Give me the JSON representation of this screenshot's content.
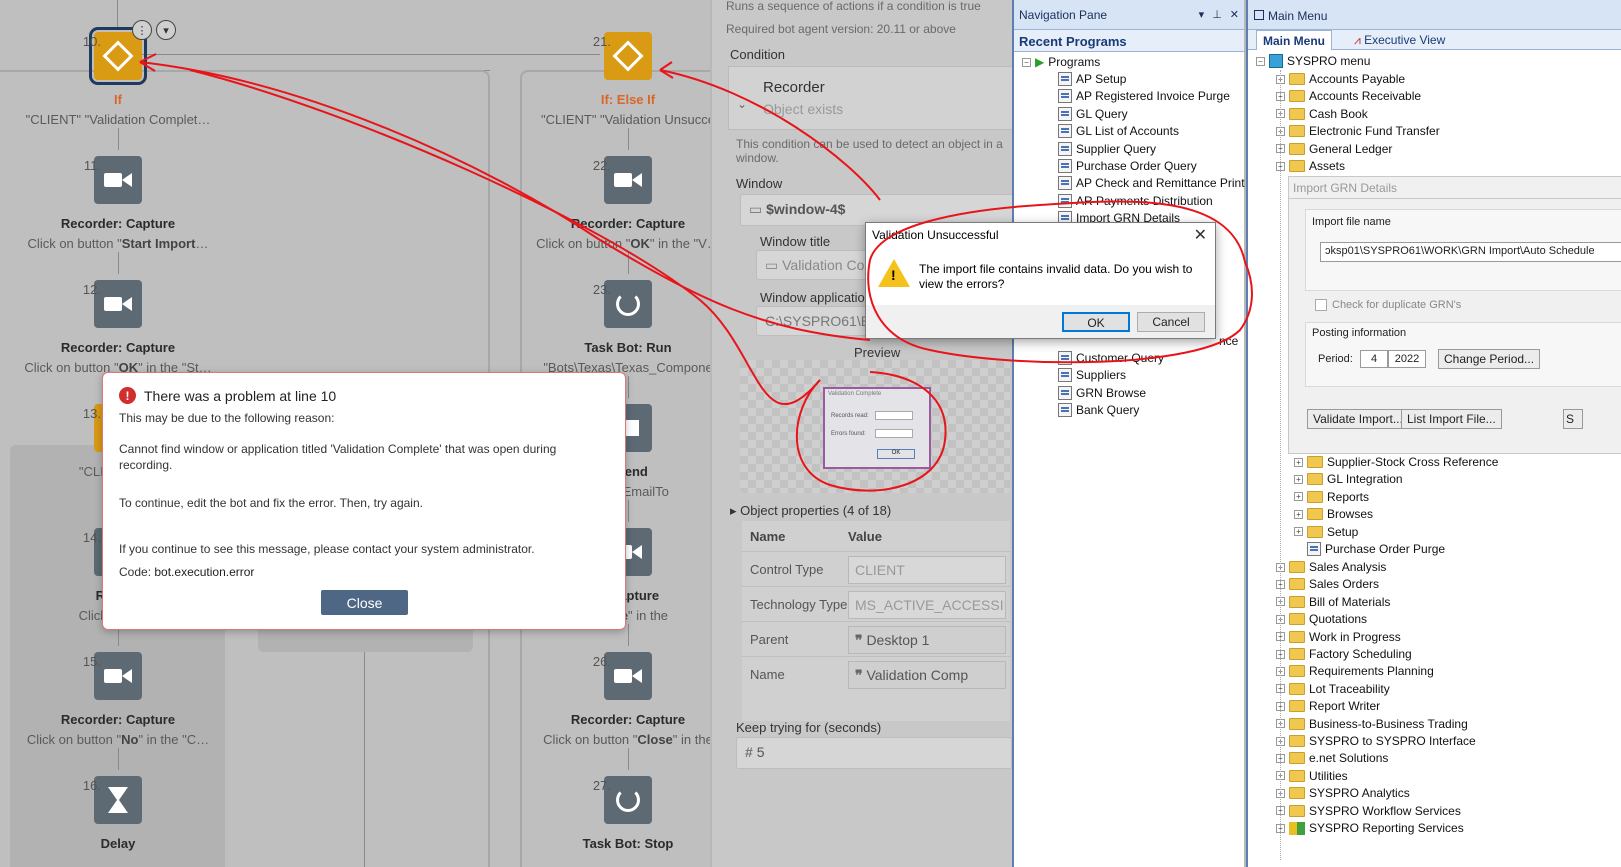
{
  "flow": {
    "left_steps": [
      {
        "num": "10.",
        "title": "If",
        "sub_prefix": "\"CLIENT\" \"Validation Complet",
        "sub_bold": "",
        "sub_suffix": "…"
      },
      {
        "num": "11.",
        "title": "Recorder: Capture",
        "sub_prefix": "Click on button \"",
        "sub_bold": "Start Import",
        "sub_suffix": "…"
      },
      {
        "num": "12.",
        "title": "Recorder: Capture",
        "sub_prefix": "Click on button \"",
        "sub_bold": "OK",
        "sub_suffix": "\" in the \"St…"
      },
      {
        "num": "13.",
        "title": "",
        "sub_prefix": "\"CLIENT\" \"Im",
        "sub_bold": "",
        "sub_suffix": ""
      },
      {
        "num": "14.",
        "title": "Record",
        "sub_prefix": "Click on butto",
        "sub_bold": "",
        "sub_suffix": ""
      },
      {
        "num": "15.",
        "title": "Recorder: Capture",
        "sub_prefix": "Click on button \"",
        "sub_bold": "No",
        "sub_suffix": "\" in the \"C…"
      },
      {
        "num": "16.",
        "title": "Delay",
        "sub_prefix": "",
        "sub_bold": "",
        "sub_suffix": ""
      }
    ],
    "right_steps": [
      {
        "num": "21.",
        "title": "If: Else If",
        "sub_prefix": "\"CLIENT\" \"Validation Unsucce",
        "sub_bold": "",
        "sub_suffix": ""
      },
      {
        "num": "22.",
        "title": "Recorder: Capture",
        "sub_prefix": "Click on button \"",
        "sub_bold": "OK",
        "sub_suffix": "\" in the \"V…"
      },
      {
        "num": "23.",
        "title": "Task Bot: Run",
        "sub_prefix": "\"Bots\\Texas\\Texas_Compone",
        "sub_bold": "",
        "sub_suffix": ""
      },
      {
        "num": "",
        "title": ": Send",
        "sub_prefix": "_sendEmailTo",
        "sub_bold": "",
        "sub_suffix": ""
      },
      {
        "num": "",
        "title": "r: Capture",
        "sub_prefix": "\"",
        "sub_bold": "Close",
        "sub_suffix": "\" in the"
      },
      {
        "num": "26.",
        "title": "Recorder: Capture",
        "sub_prefix": "Click on button \"",
        "sub_bold": "Close",
        "sub_suffix": "\" in the"
      },
      {
        "num": "27.",
        "title": "Task Bot: Stop",
        "sub_prefix": "",
        "sub_bold": "",
        "sub_suffix": ""
      }
    ]
  },
  "error_dialog": {
    "title": "There was a problem at line 10",
    "reason": "This may be due to the following reason:",
    "detail": "Cannot find window or application titled 'Validation Complete' that was open during recording.",
    "instruction": "To continue, edit the bot and fix the error. Then, try again.",
    "contact": "If you continue to see this message, please contact your system administrator.",
    "code_label": "Code:",
    "code_value": "bot.execution.error",
    "close_label": "Close"
  },
  "properties": {
    "desc": "Runs a sequence of actions if a condition is true",
    "version": "Required bot agent version: 20.11 or above",
    "condition_label": "Condition",
    "condition_name": "Recorder",
    "condition_sub": "Object exists",
    "condition_help": "This condition can be used to detect an object in a window.",
    "window_label": "Window",
    "window_value": "$window-4$",
    "window_title_label": "Window title",
    "window_title_value": "Validation Co",
    "window_app_label": "Window application",
    "window_app_value": "C:\\SYSPRO61\\BA",
    "preview_label": "Preview",
    "thumb_title": "Validation Complete",
    "thumb_records": "Records read:",
    "thumb_errors": "Errors found:",
    "thumb_ok": "OK",
    "object_props": "Object properties (4 of 18)",
    "col_name": "Name",
    "col_value": "Value",
    "rows": [
      {
        "k": "Control Type",
        "v": "CLIENT"
      },
      {
        "k": "Technology Type",
        "v": "MS_ACTIVE_ACCESSII"
      },
      {
        "k": "Parent",
        "v": "Desktop 1"
      },
      {
        "k": "Name",
        "v": "Validation Comp"
      }
    ],
    "keep_trying_label": "Keep trying for (seconds)",
    "keep_trying_value": "5"
  },
  "nav": {
    "title": "Navigation Pane",
    "section": "Recent Programs",
    "root": "Programs",
    "items": [
      "AP Setup",
      "AP Registered Invoice Purge",
      "GL Query",
      "GL List of Accounts",
      "Supplier Query",
      "Purchase Order Query",
      "AP Check and Remittance Print",
      "AR Payments Distribution",
      "Import GRN Details"
    ],
    "items_bottom": [
      "Customer Query",
      "Suppliers",
      "GRN Browse",
      "Bank Query"
    ],
    "partial": "nce"
  },
  "main_menu": {
    "title": "Main Menu",
    "tab_main": "Main Menu",
    "tab_exec": "Executive View",
    "root": "SYSPRO menu",
    "top_items": [
      "Accounts Payable",
      "Accounts Receivable",
      "Cash Book",
      "Electronic Fund Transfer",
      "General Ledger",
      "Assets"
    ],
    "grn_title": "Import GRN Details",
    "import_label": "Import file name",
    "import_value": "ɔksp01\\SYSPRO61\\WORK\\GRN Import\\Auto Schedule",
    "dup_label": "Check for duplicate GRN's",
    "posting_label": "Posting information",
    "period_label": "Period:",
    "period_value": "4",
    "year_value": "2022",
    "change_period": "Change Period...",
    "validate_btn": "Validate Import...",
    "list_btn": "List Import File...",
    "sub_items": [
      "Supplier-Stock Cross Reference",
      "GL Integration",
      "Reports",
      "Browses",
      "Setup",
      "Purchase Order Purge"
    ],
    "bottom_items": [
      "Sales Analysis",
      "Sales Orders",
      "Bill of Materials",
      "Quotations",
      "Work in Progress",
      "Factory Scheduling",
      "Requirements Planning",
      "Lot Traceability",
      "Report Writer",
      "Business-to-Business Trading",
      "SYSPRO to SYSPRO Interface",
      "e.net Solutions",
      "Utilities",
      "SYSPRO Analytics",
      "SYSPRO Workflow Services",
      "SYSPRO Reporting Services"
    ]
  },
  "validation_dialog": {
    "title": "Validation Unsuccessful",
    "message": "The import file contains invalid data.  Do you wish to view the errors?",
    "ok": "OK",
    "cancel": "Cancel",
    "close_glyph": "✕"
  },
  "colors": {
    "annotation": "#e8141a",
    "if_tile": "#d99a14",
    "action_tile": "#5d6a73",
    "close_button": "#4e6785"
  }
}
